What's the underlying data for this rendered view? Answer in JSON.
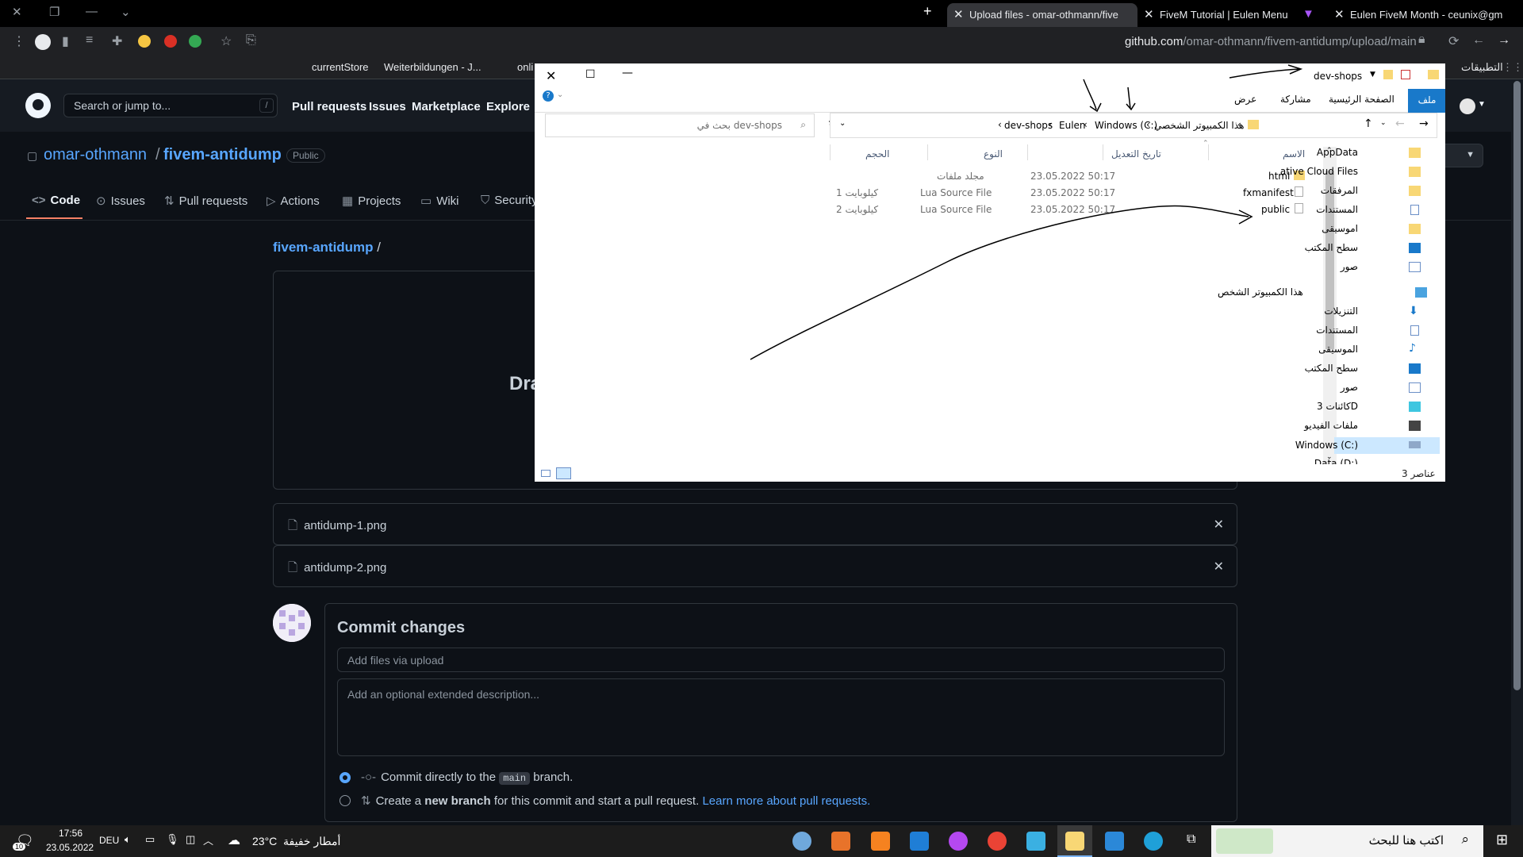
{
  "browser": {
    "tabs": [
      {
        "label": "Upload files - omar-othmann/five",
        "active": true
      },
      {
        "label": "FiveM Tutorial | Eulen Menu",
        "active": false
      },
      {
        "label": "",
        "active": false
      },
      {
        "label": "Eulen FiveM Month - ceunix@gm",
        "active": false
      }
    ],
    "url_host": "github.com",
    "url_path": "/omar-othmann/fivem-antidump/upload/main",
    "bookmarks": [
      "currentStore",
      "Weiterbildungen - J...",
      "onli"
    ],
    "apps_label": "التطبيقات"
  },
  "github": {
    "search_placeholder": "Search or jump to...",
    "search_key": "/",
    "nav": [
      "Pull requests",
      "Issues",
      "Marketplace",
      "Explore"
    ],
    "repo": {
      "owner": "omar-othmann",
      "name": "fivem-antidump",
      "visibility": "Public",
      "tabs": [
        "Code",
        "Issues",
        "Pull requests",
        "Actions",
        "Projects",
        "Wiki",
        "Security"
      ]
    },
    "breadcrumb_repo": "fivem-antidump",
    "breadcrumb_sep": "/",
    "dropzone_text": "Dra",
    "files": [
      "antidump-1.png",
      "antidump-2.png"
    ],
    "commit": {
      "title": "Commit changes",
      "summary_placeholder": "Add files via upload",
      "description_placeholder": "Add an optional extended description...",
      "option1_pre": "Commit directly to the",
      "option1_branch": "main",
      "option1_post": "branch.",
      "option2_pre": "Create a",
      "option2_bold": "new branch",
      "option2_post": "for this commit and start a pull request.",
      "option2_link": "Learn more about pull requests."
    }
  },
  "explorer": {
    "title": "dev-shops",
    "ribbon_tabs": [
      "ملف",
      "الصفحة الرئيسية",
      "مشاركة",
      "عرض"
    ],
    "address": [
      "هذا الكمبيوتر الشخصي",
      "Windows (C:)",
      "Eulen",
      "dev-shops"
    ],
    "search_placeholder": "بحث في dev-shops",
    "columns": {
      "name": "الاسم",
      "modified": "تاريخ التعديل",
      "type": "النوع",
      "size": "الحجم"
    },
    "files": [
      {
        "name": "html",
        "modified": "23.05.2022 50:17",
        "type": "مجلد ملفات",
        "size": ""
      },
      {
        "name": "fxmanifest",
        "modified": "23.05.2022 50:17",
        "type": "Lua Source File",
        "size": "1 كيلوبايت"
      },
      {
        "name": "public",
        "modified": "23.05.2022 50:17",
        "type": "Lua Source File",
        "size": "2 كيلوبايت"
      }
    ],
    "nav": [
      "AppData",
      "ative Cloud Files",
      "المرفقات",
      "المستندات",
      "اموسيقى",
      "سطح المكتب",
      "صور",
      "هذا الكمبيوتر الشخص",
      "التنزيلات",
      "المستندات",
      "الموسيقى",
      "سطح المكتب",
      "صور",
      "كائنات 3D",
      "ملفات الفيديو",
      "Windows (C:)",
      "Data (D:)"
    ],
    "status": "3 عناصر"
  },
  "taskbar": {
    "search_placeholder": "اكتب هنا للبحث",
    "weather": "أمطار خفيفة",
    "temperature": "23°C",
    "language": "DEU",
    "time": "17:56",
    "date": "23.05.2022",
    "notification_count": "10"
  },
  "colors": {
    "accent": "#58a6ff",
    "tab_underline": "#f78166",
    "explorer_file_tab": "#1979ca"
  }
}
